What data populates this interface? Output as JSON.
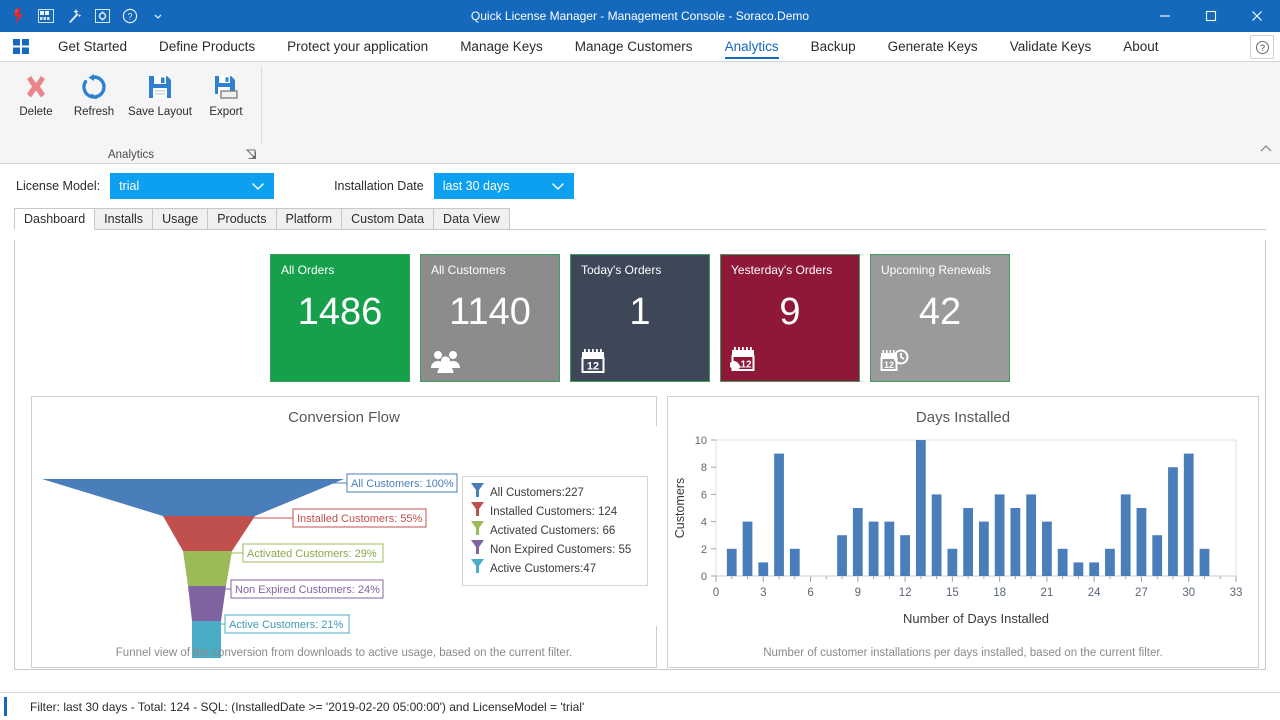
{
  "window": {
    "title": "Quick License Manager - Management Console - Soraco.Demo",
    "quick_access": [
      "ribbon-icon",
      "grid-icon",
      "wand-icon",
      "window-icon",
      "help-icon",
      "chevron-down-icon"
    ],
    "controls": {
      "minimize": "minimize-icon",
      "maximize": "maximize-icon",
      "close": "close-icon"
    }
  },
  "ribbon": {
    "tabs": [
      {
        "label": "Get Started",
        "active": false
      },
      {
        "label": "Define Products",
        "active": false
      },
      {
        "label": "Protect your application",
        "active": false
      },
      {
        "label": "Manage Keys",
        "active": false
      },
      {
        "label": "Manage Customers",
        "active": false
      },
      {
        "label": "Analytics",
        "active": true
      },
      {
        "label": "Backup",
        "active": false
      },
      {
        "label": "Generate Keys",
        "active": false
      },
      {
        "label": "Validate Keys",
        "active": false
      },
      {
        "label": "About",
        "active": false
      }
    ],
    "group_title": "Analytics",
    "buttons": [
      {
        "label": "Delete",
        "icon": "delete-x-icon"
      },
      {
        "label": "Refresh",
        "icon": "refresh-icon"
      },
      {
        "label": "Save Layout",
        "icon": "save-icon"
      },
      {
        "label": "Export",
        "icon": "export-icon"
      }
    ]
  },
  "filters": {
    "license_model_label": "License Model:",
    "license_model_value": "trial",
    "installation_date_label": "Installation Date",
    "installation_date_value": "last 30 days"
  },
  "tabs": [
    {
      "label": "Dashboard",
      "active": true
    },
    {
      "label": "Installs",
      "active": false
    },
    {
      "label": "Usage",
      "active": false
    },
    {
      "label": "Products",
      "active": false
    },
    {
      "label": "Platform",
      "active": false
    },
    {
      "label": "Custom Data",
      "active": false
    },
    {
      "label": "Data View",
      "active": false
    }
  ],
  "tiles": [
    {
      "title": "All Orders",
      "value": "1486",
      "color": "#16A04C",
      "icon": ""
    },
    {
      "title": "All Customers",
      "value": "1140",
      "color": "#8C8C8C",
      "icon": "people-icon"
    },
    {
      "title": "Today's Orders",
      "value": "1",
      "color": "#3D4758",
      "icon": "calendar-icon"
    },
    {
      "title": "Yesterday's Orders",
      "value": "9",
      "color": "#8F1838",
      "icon": "calendar-hand-icon"
    },
    {
      "title": "Upcoming Renewals",
      "value": "42",
      "color": "#9A9A9A",
      "icon": "calendar-clock-icon"
    }
  ],
  "funnel_panel": {
    "title": "Conversion Flow",
    "footer": "Funnel view of the conversion from downloads to active usage, based on the current filter."
  },
  "days_panel": {
    "title": "Days Installed",
    "footer": "Number of customer installations per days installed, based on the current filter."
  },
  "statusbar": {
    "text": "Filter: last 30 days - Total: 124 - SQL:  (InstalledDate >= '2019-02-20 05:00:00') and  LicenseModel = 'trial'"
  },
  "chart_data": [
    {
      "type": "funnel",
      "title": "Conversion Flow",
      "stages": [
        {
          "name": "All Customers",
          "value": 227,
          "percent": "100%",
          "label": "All Customers: 100%",
          "legend": "All Customers:227",
          "color": "#4A7EBB"
        },
        {
          "name": "Installed Customers",
          "value": 124,
          "percent": "55%",
          "label": "Installed Customers: 55%",
          "legend": "Installed Customers: 124",
          "color": "#C0504D"
        },
        {
          "name": "Activated Customers",
          "value": 66,
          "percent": "29%",
          "label": "Activated Customers: 29%",
          "legend": "Activated Customers: 66",
          "color": "#9BBB59"
        },
        {
          "name": "Non Expired Customers",
          "value": 55,
          "percent": "24%",
          "label": "Non Expired Customers: 24%",
          "legend": "Non Expired Customers: 55",
          "color": "#8064A2"
        },
        {
          "name": "Active Customers",
          "value": 47,
          "percent": "21%",
          "label": "Active Customers: 21%",
          "legend": "Active Customers:47",
          "color": "#4BACC6"
        }
      ],
      "legend_position": "right"
    },
    {
      "type": "bar",
      "title": "Days Installed",
      "xlabel": "Number of Days Installed",
      "ylabel": "Customers",
      "xlim": [
        0,
        33
      ],
      "ylim": [
        0,
        10
      ],
      "xticks": [
        0,
        3,
        6,
        9,
        12,
        15,
        18,
        21,
        24,
        27,
        30,
        33
      ],
      "yticks": [
        0,
        2,
        4,
        6,
        8,
        10
      ],
      "grid": false,
      "bar_color": "#4A7EBB",
      "x": [
        1,
        2,
        3,
        4,
        5,
        8,
        9,
        10,
        11,
        12,
        13,
        14,
        15,
        16,
        17,
        18,
        19,
        20,
        21,
        22,
        23,
        24,
        25,
        26,
        27,
        28,
        29,
        30,
        31
      ],
      "values": [
        2,
        4,
        1,
        9,
        2,
        3,
        5,
        4,
        4,
        3,
        10,
        6,
        2,
        5,
        4,
        6,
        5,
        6,
        4,
        2,
        1,
        1,
        2,
        6,
        5,
        3,
        8,
        9,
        2
      ]
    }
  ]
}
